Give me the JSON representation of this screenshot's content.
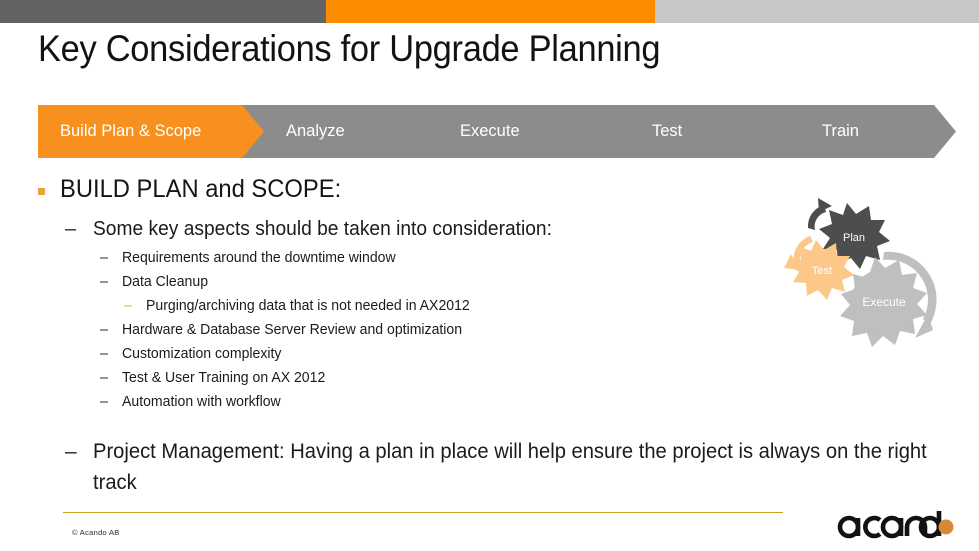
{
  "topbar": {
    "segments": [
      {
        "name": "dark",
        "color": "#636363"
      },
      {
        "name": "orange",
        "color": "#FB8C00"
      },
      {
        "name": "light",
        "color": "#C7C7C7"
      }
    ]
  },
  "slide": {
    "title": "Key Considerations for Upgrade Planning"
  },
  "process_bar": {
    "active_index": 0,
    "active_color": "#F7901E",
    "inactive_color": "#8C8C8C",
    "steps": [
      {
        "label": "Build Plan & Scope"
      },
      {
        "label": "Analyze"
      },
      {
        "label": "Execute"
      },
      {
        "label": "Test"
      },
      {
        "label": "Train"
      }
    ]
  },
  "body": {
    "heading": "BUILD PLAN and SCOPE:",
    "lead": "Some key aspects should be taken into consideration:",
    "items_l3_a": [
      {
        "text": "Requirements around the downtime window"
      },
      {
        "text": "Data Cleanup"
      }
    ],
    "item_l4": "Purging/archiving data that is not needed in AX2012",
    "items_l3_b": [
      {
        "text": "Hardware & Database Server Review and optimization"
      },
      {
        "text": "Customization complexity"
      },
      {
        "text": "Test & User Training on AX 2012"
      },
      {
        "text": "Automation with workflow"
      }
    ],
    "final": "Project Management: Having a plan in place will help ensure the project is always on the right track"
  },
  "gears": {
    "plan": {
      "label": "Plan",
      "color": "#4D4D4D"
    },
    "test": {
      "label": "Test",
      "color": "#FBC88A"
    },
    "execute": {
      "label": "Execute",
      "color": "#BFBFBF"
    }
  },
  "footer": {
    "copyright": "© Acando AB",
    "rule_color": "#C9A227",
    "logo_text": "acando",
    "logo_accent_color": "#D9883A"
  }
}
